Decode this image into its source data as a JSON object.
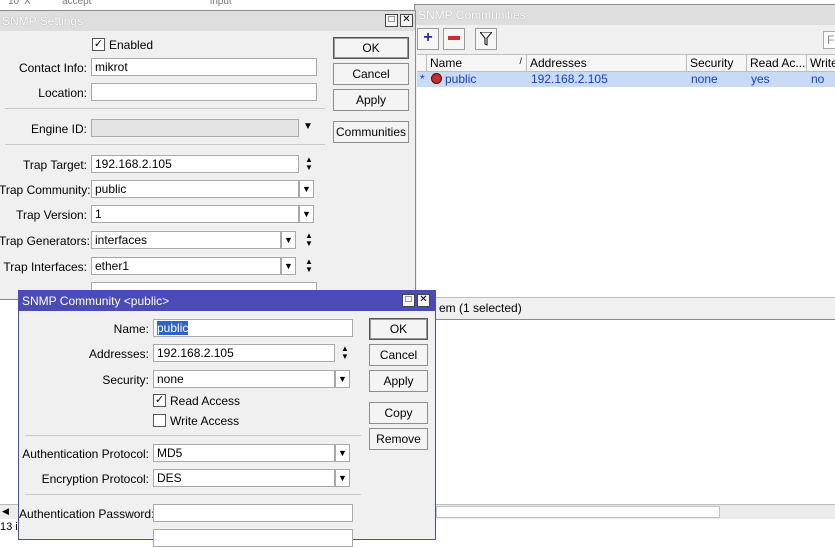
{
  "background_row": {
    "cells": [
      "10",
      "X",
      "accept",
      "input"
    ]
  },
  "snmp_settings": {
    "title": "SNMP Settings",
    "enabled_label": "Enabled",
    "enabled_checked": true,
    "contact_info_label": "Contact Info:",
    "contact_info_value": "mikrot",
    "location_label": "Location:",
    "location_value": "",
    "engine_id_label": "Engine ID:",
    "engine_id_value": "",
    "trap_target_label": "Trap Target:",
    "trap_target_value": "192.168.2.105",
    "trap_community_label": "Trap Community:",
    "trap_community_value": "public",
    "trap_version_label": "Trap Version:",
    "trap_version_value": "1",
    "trap_generators_label": "Trap Generators:",
    "trap_generators_value": "interfaces",
    "trap_interfaces_label": "Trap Interfaces:",
    "trap_interfaces_value": "ether1",
    "ok_label": "OK",
    "cancel_label": "Cancel",
    "apply_label": "Apply",
    "communities_label": "Communities"
  },
  "snmp_communities": {
    "title": "SNMP Communities",
    "search_placeholder": "F",
    "columns": [
      "Name",
      "Addresses",
      "Security",
      "Read Ac...",
      "Write"
    ],
    "rows": [
      {
        "marker": "*",
        "name": "public",
        "addresses": "192.168.2.105",
        "security": "none",
        "read": "yes",
        "write": "no"
      }
    ],
    "status": "em (1 selected)"
  },
  "snmp_community_dialog": {
    "title": "SNMP Community <public>",
    "name_label": "Name:",
    "name_value": "public",
    "addresses_label": "Addresses:",
    "addresses_value": "192.168.2.105",
    "security_label": "Security:",
    "security_value": "none",
    "read_access_label": "Read Access",
    "read_access_checked": true,
    "write_access_label": "Write Access",
    "write_access_checked": false,
    "auth_protocol_label": "Authentication Protocol:",
    "auth_protocol_value": "MD5",
    "enc_protocol_label": "Encryption Protocol:",
    "enc_protocol_value": "DES",
    "auth_password_label": "Authentication Password:",
    "auth_password_value": "",
    "ok_label": "OK",
    "cancel_label": "Cancel",
    "apply_label": "Apply",
    "copy_label": "Copy",
    "remove_label": "Remove"
  },
  "bottom_status": "13 i",
  "colors": {
    "accent_title": "#4b4bb8",
    "selection_row": "#c9daf5",
    "link_blue": "#1240c8"
  }
}
